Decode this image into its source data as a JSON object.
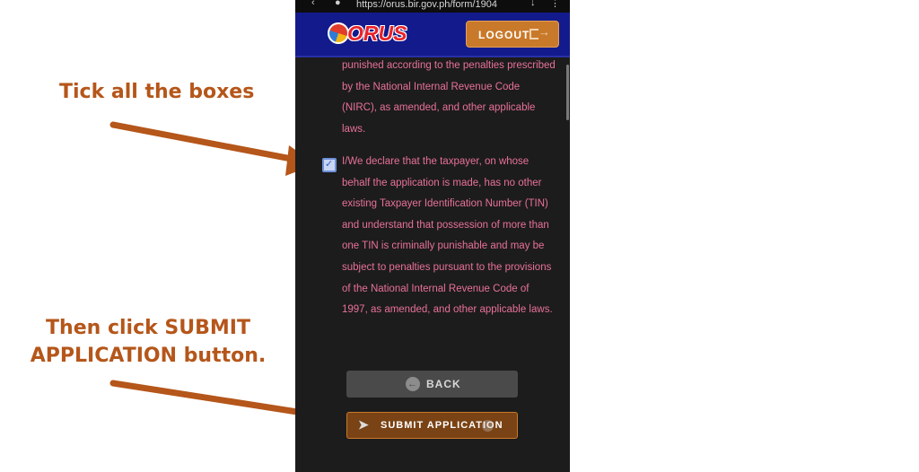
{
  "browser": {
    "url": "https://orus.bir.gov.ph/form/1904"
  },
  "header": {
    "logo_text": "ORUS",
    "logout_label": "LOGOUT"
  },
  "form": {
    "paragraph_1": "punished according to the penalties prescribed by the National Internal Revenue Code (NIRC), as amended, and other applicable laws.",
    "declaration_text": "I/We declare that the taxpayer, on whose behalf the application is made, has no other existing Taxpayer Identification Number (TIN) and understand that possession of more than one TIN is criminally punishable and may be subject to penalties pursuant to the provisions of the National Internal Revenue Code of 1997, as amended, and other applicable laws.",
    "declaration_checked": true,
    "back_label": "BACK",
    "submit_label": "SUBMIT APPLICATION"
  },
  "annotations": {
    "tick_instruction": "Tick all the boxes",
    "submit_instruction_line1": "Then click SUBMIT",
    "submit_instruction_line2": "APPLICATION button."
  },
  "colors": {
    "annotation": "#b5561a",
    "header_bg": "#131a8c",
    "button_orange": "#c9792a",
    "text_pink": "#e8719a"
  },
  "icons": [
    "back-arrow-icon",
    "send-plane-icon",
    "logout-icon",
    "check-icon"
  ]
}
